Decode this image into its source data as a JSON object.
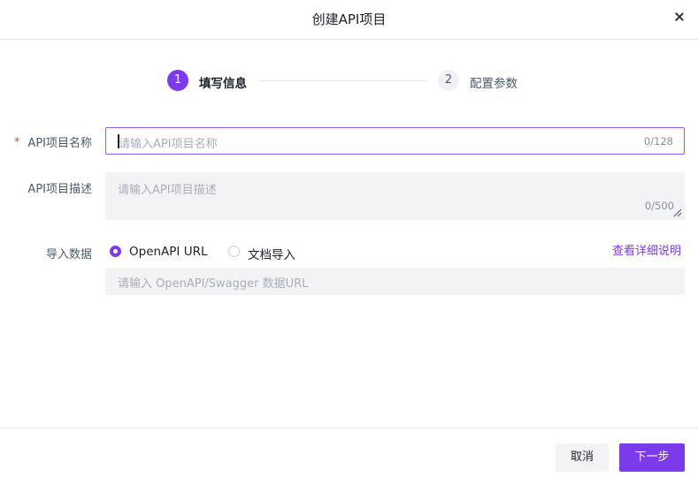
{
  "dialog": {
    "title": "创建API项目",
    "close_icon": "close-icon"
  },
  "steps": [
    {
      "number": "1",
      "label": "填写信息",
      "active": true
    },
    {
      "number": "2",
      "label": "配置参数",
      "active": false
    }
  ],
  "form": {
    "name": {
      "label": "API项目名称",
      "required_mark": "*",
      "value": "",
      "placeholder": "请输入API项目名称",
      "count": "0/128"
    },
    "description": {
      "label": "API项目描述",
      "value": "",
      "placeholder": "请输入API项目描述",
      "count": "0/500"
    },
    "import": {
      "label": "导入数据",
      "options": [
        {
          "label": "OpenAPI URL",
          "selected": true
        },
        {
          "label": "文档导入",
          "selected": false
        }
      ],
      "help_link": "查看详细说明",
      "url_placeholder": "请输入 OpenAPI/Swagger 数据URL"
    }
  },
  "footer": {
    "cancel_label": "取消",
    "next_label": "下一步"
  },
  "colors": {
    "accent": "#7c3aed",
    "required": "#f53f3f"
  }
}
